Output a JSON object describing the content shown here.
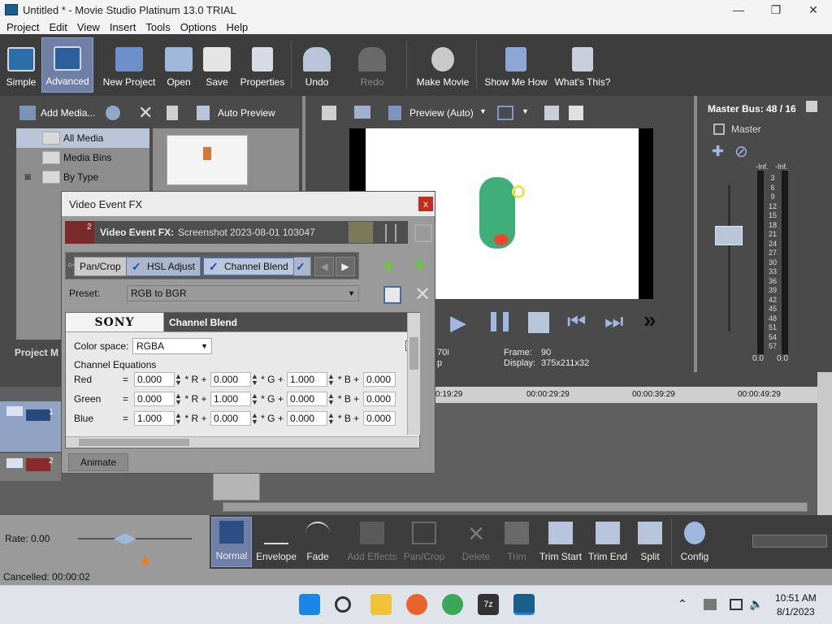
{
  "window": {
    "title": "Untitled * - Movie Studio Platinum 13.0 TRIAL"
  },
  "menu": [
    "Project",
    "Edit",
    "View",
    "Insert",
    "Tools",
    "Options",
    "Help"
  ],
  "toolbar": {
    "simple": "Simple",
    "advanced": "Advanced",
    "new_project": "New Project",
    "open": "Open",
    "save": "Save",
    "properties": "Properties",
    "undo": "Undo",
    "redo": "Redo",
    "make_movie": "Make Movie",
    "show_me_how": "Show Me How",
    "whats_this": "What's This?"
  },
  "media_panel": {
    "add_media": "Add Media...",
    "auto_preview": "Auto Preview",
    "tree": [
      "All Media",
      "Media Bins",
      "By Type"
    ],
    "project_label": "Project M"
  },
  "preview": {
    "mode": "Preview (Auto)",
    "frame_label": "Frame:",
    "frame_value": "90",
    "display_label": "Display:",
    "display_value": "375x211x32",
    "left_partial": "70i",
    "left_partial2": "p"
  },
  "master": {
    "title": "Master Bus: 48 / 16",
    "label": "Master",
    "inf_left": "-Inf.",
    "inf_right": "-Inf.",
    "scale": [
      "3",
      "6",
      "9",
      "12",
      "15",
      "18",
      "21",
      "24",
      "27",
      "30",
      "33",
      "36",
      "39",
      "42",
      "45",
      "48",
      "51",
      "54",
      "57"
    ],
    "val_left": "0.0",
    "val_right": "0.0"
  },
  "dialog": {
    "title": "Video Event FX",
    "close": "x",
    "fx_header_label": "Video Event FX:",
    "fx_header_value": "Screenshot 2023-08-01 103047",
    "track_num": "2",
    "chain": [
      "Pan/Crop",
      "HSL Adjust",
      "Channel Blend"
    ],
    "preset_label": "Preset:",
    "preset_value": "RGB to BGR",
    "sony": "SONY",
    "plugin_name": "Channel Blend",
    "color_space_label": "Color space:",
    "color_space_value": "RGBA",
    "equations_label": "Channel Equations",
    "rows": [
      {
        "name": "Red",
        "v0": "0.000",
        "vr": "0.000",
        "vg": "1.000",
        "vb": "0.000"
      },
      {
        "name": "Green",
        "v0": "0.000",
        "vr": "1.000",
        "vg": "0.000",
        "vb": "0.000"
      },
      {
        "name": "Blue",
        "v0": "1.000",
        "vr": "0.000",
        "vg": "0.000",
        "vb": "0.000"
      }
    ],
    "eq": "=",
    "r_op": "* R +",
    "g_op": "* G +",
    "b_op": "* B +",
    "animate": "Animate"
  },
  "timeline": {
    "marks": [
      "0:19:29",
      "00:00:29:29",
      "00:00:39:29",
      "00:00:49:29"
    ],
    "track1_num": "1",
    "track2_num": "2"
  },
  "edit_tools": [
    "Normal",
    "Envelope",
    "Fade",
    "Add Effects",
    "Pan/Crop",
    "Delete",
    "Trim",
    "Trim Start",
    "Trim End",
    "Split",
    "Config"
  ],
  "rate": "Rate: 0.00",
  "status": "Cancelled: 00:00:02",
  "clock": {
    "time": "10:51 AM",
    "date": "8/1/2023"
  },
  "colors": {
    "accent": "#6f7fa6",
    "close_red": "#c42b1c",
    "chip_blue": "#a9b6cc"
  }
}
